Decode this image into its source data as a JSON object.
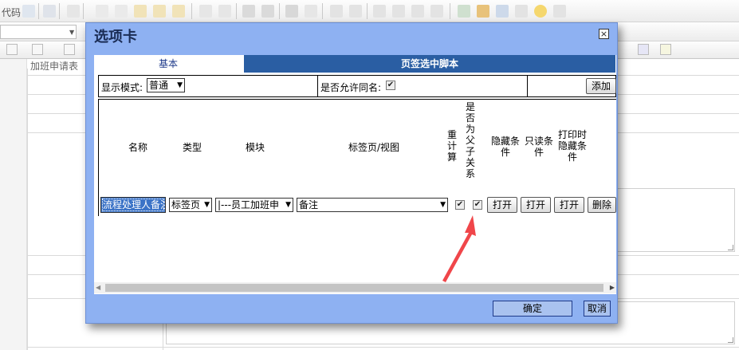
{
  "editor": {
    "toolbar_text": "代码",
    "doc_title": "加班申请表"
  },
  "dialog": {
    "title": "选项卡",
    "close_glyph": "×"
  },
  "tabs": [
    {
      "label": "基本"
    },
    {
      "label": "页签选中脚本"
    }
  ],
  "options": {
    "display_mode_label": "显示模式:",
    "display_mode_value": "普通",
    "allow_same_name_label": "是否允许同名:",
    "allow_same_name_checked": "✔",
    "add_button": "添加"
  },
  "table": {
    "headers": {
      "name": "名称",
      "type": "类型",
      "module": "模块",
      "tab_view": "标签页/视图",
      "recalc": "重\n计\n算",
      "is_parent_child": "是\n否\n为\n父\n子\n关\n系",
      "hide_cond": "隐藏条\n件",
      "readonly_cond": "只读条\n件",
      "print_hide_cond": "打印时\n隐藏条\n件"
    },
    "row": {
      "name": "流程处理人备注",
      "type": "标签页",
      "module": "|---员工加班申",
      "tab_view": "备注",
      "recalc_checked": "✔",
      "parent_child_checked": "✔",
      "open1": "打开",
      "open2": "打开",
      "open3": "打开",
      "delete": "删除"
    }
  },
  "footer": {
    "ok": "确定",
    "cancel": "取消"
  },
  "colors": {
    "dialog_bg": "#8eb1f2",
    "tab_active": "#2a5ea3",
    "arrow": "#f0464a"
  }
}
